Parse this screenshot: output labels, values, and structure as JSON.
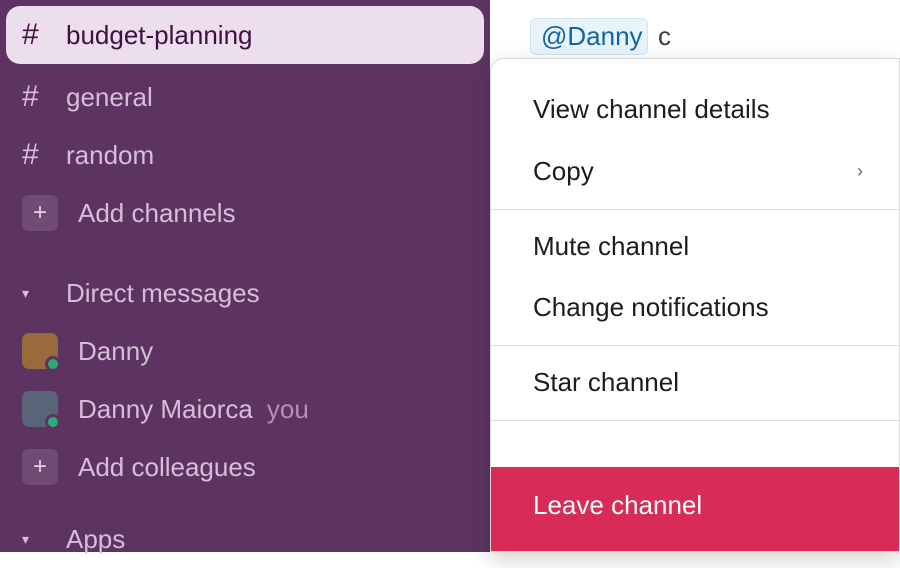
{
  "sidebar": {
    "channels": [
      {
        "name": "budget-planning",
        "active": true
      },
      {
        "name": "general",
        "active": false
      },
      {
        "name": "random",
        "active": false
      }
    ],
    "add_channels_label": "Add channels",
    "dm_section_label": "Direct messages",
    "dms": [
      {
        "name": "Danny",
        "you": false
      },
      {
        "name": "Danny Maiorca",
        "you": true
      }
    ],
    "you_label": "you",
    "add_colleagues_label": "Add colleagues",
    "apps_section_label": "Apps"
  },
  "main": {
    "mention_text": "@Danny"
  },
  "context_menu": {
    "view_details": "View channel details",
    "copy": "Copy",
    "mute": "Mute channel",
    "change_notifications": "Change notifications",
    "star": "Star channel",
    "leave": "Leave channel"
  }
}
